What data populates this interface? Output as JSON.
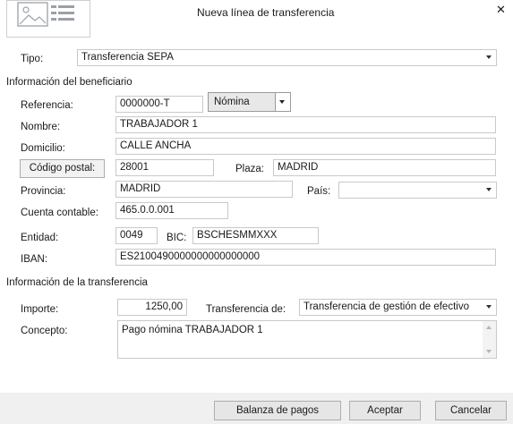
{
  "dialog": {
    "title": "Nueva línea de transferencia",
    "close_symbol": "✕"
  },
  "tipo": {
    "label": "Tipo:",
    "value": "Transferencia SEPA"
  },
  "beneficiario": {
    "section_title": "Información del beneficiario",
    "referencia_label": "Referencia:",
    "referencia_value": "0000000-T",
    "referencia_tipo": "Nómina",
    "nombre_label": "Nombre:",
    "nombre_value": "TRABAJADOR 1",
    "domicilio_label": "Domicilio:",
    "domicilio_value": "CALLE ANCHA",
    "codigo_postal_button": "Código postal:",
    "codigo_postal_value": "28001",
    "plaza_label": "Plaza:",
    "plaza_value": "MADRID",
    "provincia_label": "Provincia:",
    "provincia_value": "MADRID",
    "pais_label": "País:",
    "pais_value": "",
    "cuenta_label": "Cuenta contable:",
    "cuenta_value": "465.0.0.001",
    "entidad_label": "Entidad:",
    "entidad_value": "0049",
    "bic_label": "BIC:",
    "bic_value": "BSCHESMMXXX",
    "iban_label": "IBAN:",
    "iban_value": "ES2100490000000000000000"
  },
  "transferencia": {
    "section_title": "Información de la transferencia",
    "importe_label": "Importe:",
    "importe_value": "1250,00",
    "transferencia_de_label": "Transferencia de:",
    "transferencia_de_value": "Transferencia de gestión de efectivo",
    "concepto_label": "Concepto:",
    "concepto_value": "Pago nómina TRABAJADOR 1"
  },
  "footer": {
    "balanza_button": "Balanza de pagos",
    "aceptar_button": "Aceptar",
    "cancelar_button": "Cancelar"
  },
  "icons": {
    "header": "transfer-document-icon",
    "close": "close-icon",
    "dropdown": "chevron-down-icon",
    "scroll_up": "scroll-up-icon",
    "scroll_down": "scroll-down-icon"
  }
}
